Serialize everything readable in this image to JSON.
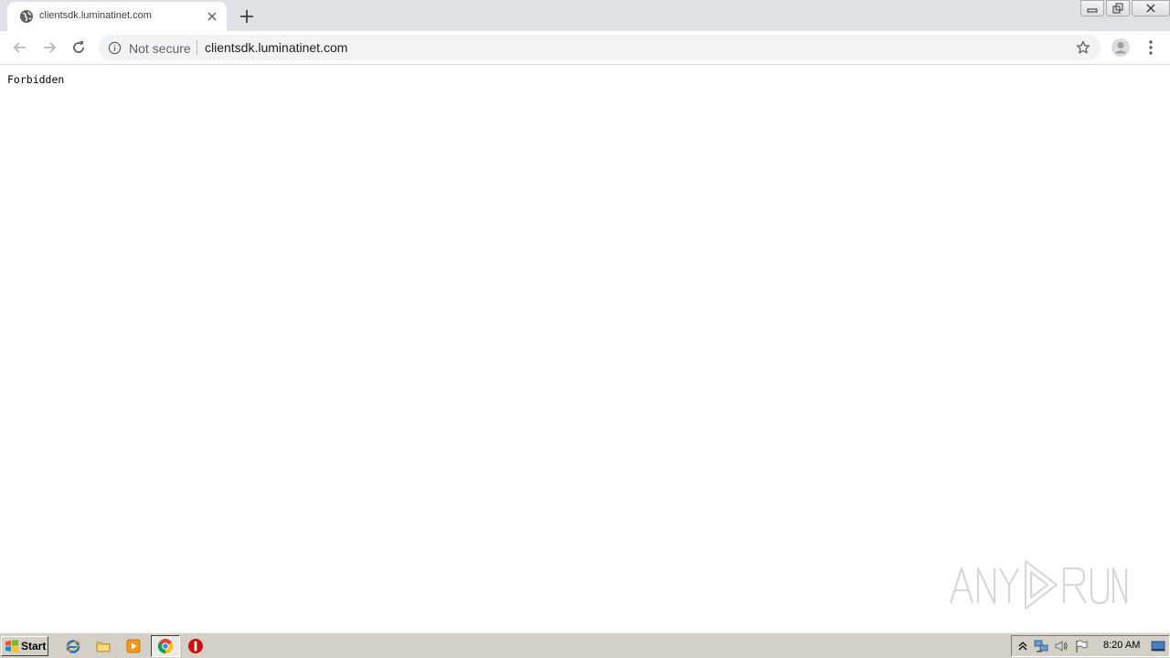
{
  "browser": {
    "tab": {
      "title": "clientsdk.luminatinet.com"
    },
    "omnibox": {
      "security_label": "Not secure",
      "url": "clientsdk.luminatinet.com"
    }
  },
  "page": {
    "body_text": "Forbidden"
  },
  "watermark": {
    "text": "ANY RUN"
  },
  "taskbar": {
    "start_label": "Start",
    "clock": "8:20 AM"
  },
  "colors": {
    "tabstrip": "#dee1e6",
    "omnibox": "#f1f3f4",
    "taskbar": "#d4d0c8"
  }
}
